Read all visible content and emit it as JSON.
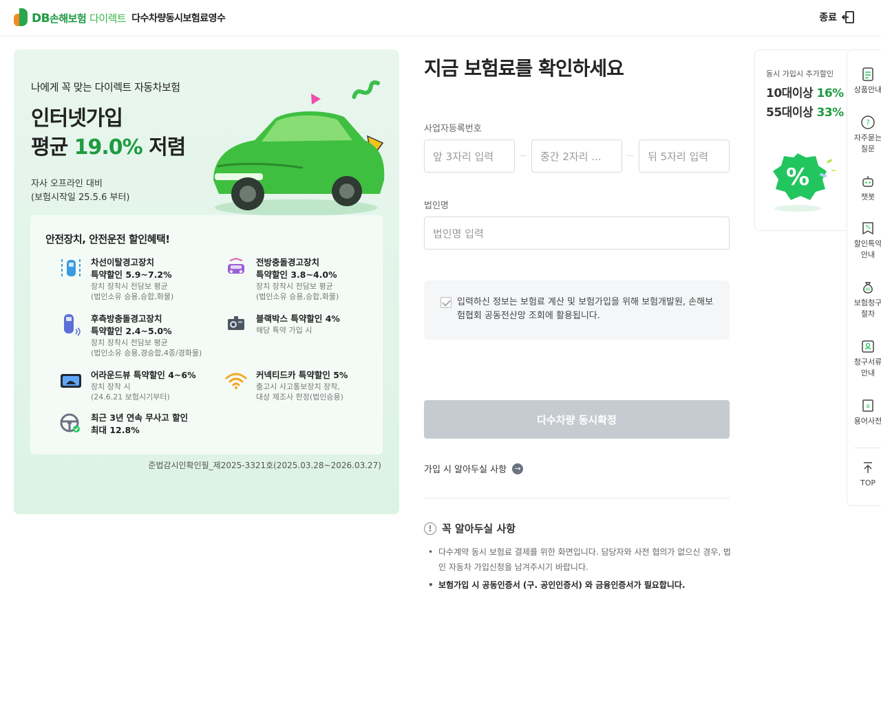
{
  "header": {
    "logo_db": "DB",
    "logo_brand": "손해보험",
    "logo_direct": "다이렉트",
    "page_title": "다수차량동시보험료영수",
    "exit_label": "종료"
  },
  "promo": {
    "subtitle": "나에게 꼭 맞는 다이렉트 자동차보험",
    "title_line1": "인터넷가입",
    "title_line2_prefix": "평균",
    "title_line2_pct": "19.0%",
    "title_line2_suffix": "저렴",
    "note_line1": "자사 오프라인 대비",
    "note_line2": "(보험시작일 25.5.6 부터)",
    "benefit_heading": "안전장치, 안전운전 할인혜택!",
    "benefits": [
      {
        "title1": "차선이탈경고장치",
        "title2": "특약할인 5.9~7.2%",
        "desc1": "장치 장착시 전담보 평균",
        "desc2": "(법인소유 승용,승합,화물)"
      },
      {
        "title1": "전방충돌경고장치",
        "title2": "특약할인 3.8~4.0%",
        "desc1": "장치 장착시 전담보 평균",
        "desc2": "(법인소유 승용,승합,화물)"
      },
      {
        "title1": "후측방충돌경고장치",
        "title2": "특약할인 2.4~5.0%",
        "desc1": "장치 장착시 전담보 평균",
        "desc2": "(법인소유 승용,경승합,4종/경화물)"
      },
      {
        "title1": "블랙박스 특약할인 4%",
        "title2": "",
        "desc1": "해당 특약 가입 시",
        "desc2": ""
      },
      {
        "title1": "어라운드뷰 특약할인 4~6%",
        "title2": "",
        "desc1": "장치 장착 시",
        "desc2": "(24.6.21 보험시기부터)"
      },
      {
        "title1": "커넥티드카 특약할인 5%",
        "title2": "",
        "desc1": "출고시 사고통보장치 장착,",
        "desc2": "대상 제조사 한정(법인승용)"
      },
      {
        "title1": "최근 3년 연속 무사고 할인",
        "title2": "최대 12.8%",
        "desc1": "",
        "desc2": ""
      }
    ],
    "footer": "준법감시인확인필_제2025-3321호(2025.03.28~2026.03.27)"
  },
  "form": {
    "title": "지금 보험료를 확인하세요",
    "biz_label": "사업자등록번호",
    "biz_ph1": "앞 3자리 입력",
    "biz_ph2": "중간 2자리 ...",
    "biz_ph3": "뒤 5자리 입력",
    "corp_label": "법인명",
    "corp_ph": "법인명 입력",
    "consent_text": "입력하신 정보는 보험료 계산 및 보험가입을 위해 보험개발원, 손해보험협회 공동전산망 조회에 활용됩니다.",
    "confirm_label": "다수차량 동시확정",
    "know_link": "가입 시 알아두실 사항",
    "must_heading": "꼭 알아두실 사항",
    "must_items": [
      "다수계약 동시 보험료 결제를 위한 화면입니다. 담당자와 사전 협의가 없으신 경우, 법인 자동차 가입신청을 남겨주시기 바랍니다.",
      "보험가입 시 공동인증서 (구. 공인인증서) 와 금융인증서가 필요합니다."
    ]
  },
  "side_card": {
    "subtitle": "동시 가입시 추가할인",
    "line1_prefix": "10대이상",
    "line1_pct": "16%",
    "line2_prefix": "55대이상",
    "line2_pct": "33%"
  },
  "quick_menu": {
    "items": [
      "상품안내",
      "자주묻는\n질문",
      "챗봇",
      "할인특약\n안내",
      "보험청구\n절차",
      "청구서류\n안내",
      "용어사전"
    ],
    "top": "TOP"
  },
  "colors": {
    "brand_green": "#1e9a41",
    "button_disabled": "#c6cbd1",
    "promo_bg": "#e3f4e9"
  }
}
